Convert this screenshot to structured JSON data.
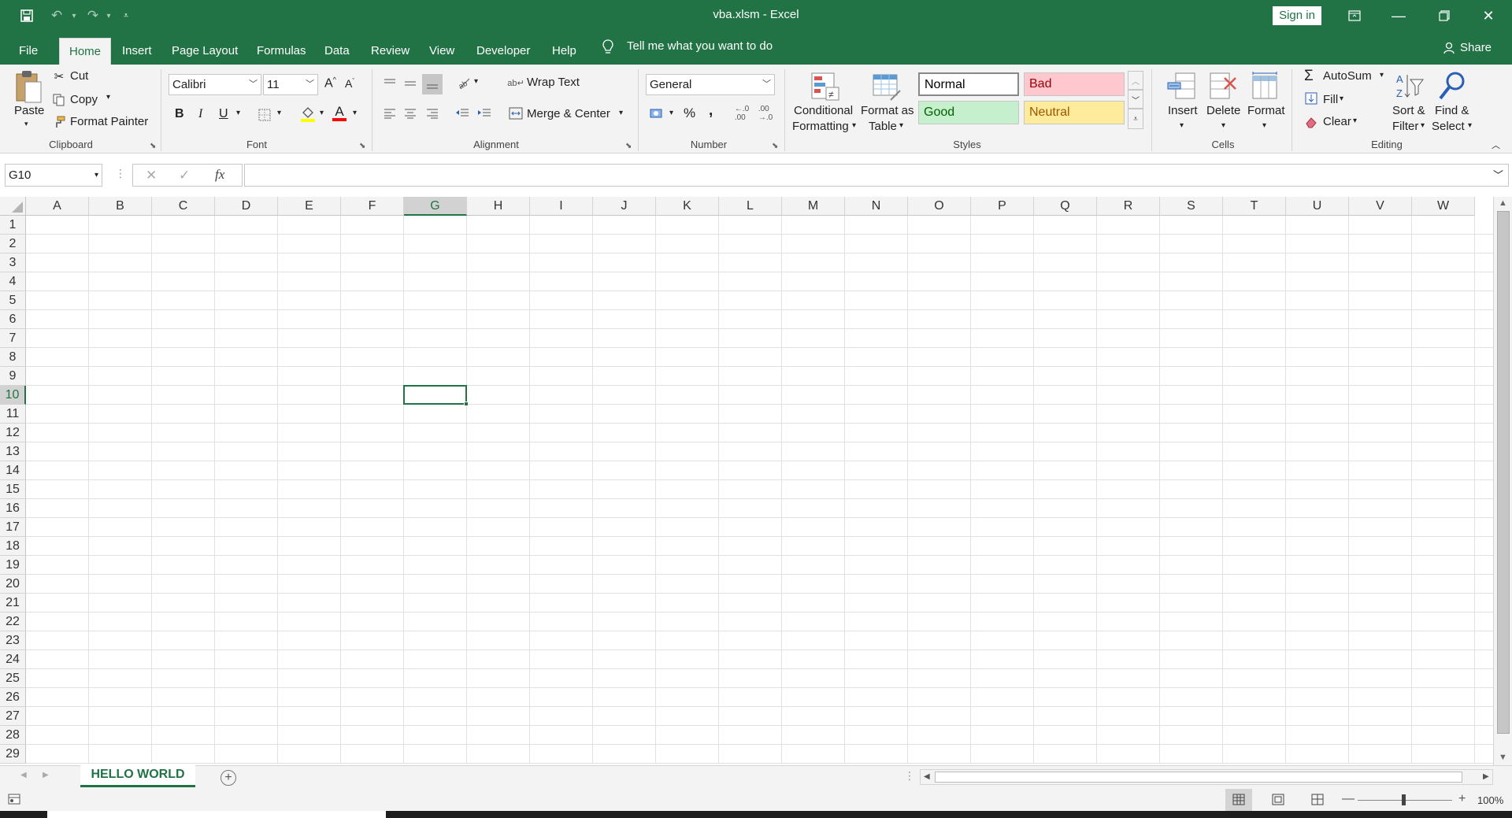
{
  "window": {
    "title": "vba.xlsm  -  Excel",
    "sign_in": "Sign in"
  },
  "tabs": [
    "File",
    "Home",
    "Insert",
    "Page Layout",
    "Formulas",
    "Data",
    "Review",
    "View",
    "Developer",
    "Help"
  ],
  "tell_me": "Tell me what you want to do",
  "share": "Share",
  "clipboard": {
    "paste": "Paste",
    "cut": "Cut",
    "copy": "Copy",
    "format_painter": "Format Painter",
    "label": "Clipboard"
  },
  "font": {
    "name": "Calibri",
    "size": "11",
    "bold": "B",
    "italic": "I",
    "underline": "U",
    "label": "Font"
  },
  "alignment": {
    "wrap_text": "Wrap Text",
    "merge_center": "Merge & Center",
    "label": "Alignment"
  },
  "number": {
    "format": "General",
    "percent": "%",
    "comma": ",",
    "label": "Number"
  },
  "styles": {
    "conditional_1": "Conditional",
    "conditional_2": "Formatting",
    "format_table_1": "Format as",
    "format_table_2": "Table",
    "normal": "Normal",
    "bad": "Bad",
    "good": "Good",
    "neutral": "Neutral",
    "label": "Styles"
  },
  "cells": {
    "insert": "Insert",
    "delete": "Delete",
    "format": "Format",
    "label": "Cells"
  },
  "editing": {
    "autosum": "AutoSum",
    "fill": "Fill",
    "clear": "Clear",
    "sort_1": "Sort &",
    "sort_2": "Filter",
    "find_1": "Find &",
    "find_2": "Select",
    "label": "Editing"
  },
  "formula_bar": {
    "name_box": "G10",
    "fx": "fx",
    "value": ""
  },
  "columns": [
    "A",
    "B",
    "C",
    "D",
    "E",
    "F",
    "G",
    "H",
    "I",
    "J",
    "K",
    "L",
    "M",
    "N",
    "O",
    "P",
    "Q",
    "R",
    "S",
    "T",
    "U",
    "V",
    "W"
  ],
  "rows": [
    "1",
    "2",
    "3",
    "4",
    "5",
    "6",
    "7",
    "8",
    "9",
    "10",
    "11",
    "12",
    "13",
    "14",
    "15",
    "16",
    "17",
    "18",
    "19",
    "20",
    "21",
    "22",
    "23",
    "24",
    "25",
    "26",
    "27",
    "28",
    "29"
  ],
  "active_cell": {
    "column": "G",
    "row": "10"
  },
  "sheet": {
    "name": "HELLO WORLD"
  },
  "status": {
    "zoom": "100%"
  },
  "colors": {
    "brand": "#217346",
    "bad_bg": "#ffc7ce",
    "bad_fg": "#9c0006",
    "good_bg": "#c6efce",
    "good_fg": "#006100",
    "neutral_bg": "#ffeb9c",
    "neutral_fg": "#9c5700"
  }
}
